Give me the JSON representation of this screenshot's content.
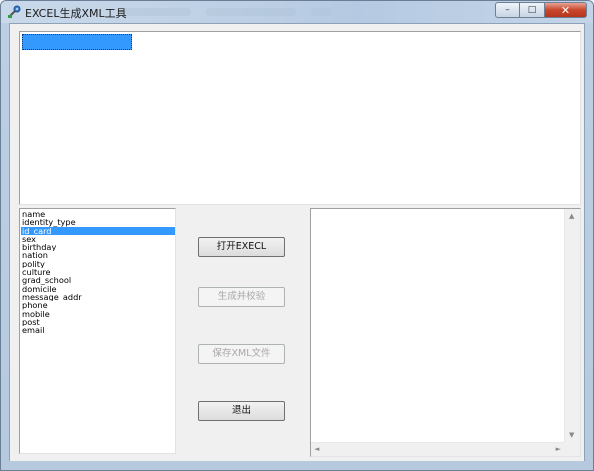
{
  "window": {
    "title": "EXCEL生成XML工具",
    "controls": {
      "minimize": "–",
      "maximize": "□",
      "close": "✕"
    }
  },
  "grid": {},
  "fields": [
    "name",
    "identity_type",
    "id_card",
    "sex",
    "birthday",
    "nation",
    "polity",
    "culture",
    "grad_school",
    "domicile",
    "message_addr",
    "phone",
    "mobile",
    "post",
    "email"
  ],
  "selected_field_index": 2,
  "buttons": {
    "open_excel": "打开EXECL",
    "generate_verify": "生成并校验",
    "save_xml": "保存XML文件",
    "exit": "退出"
  },
  "icons": {
    "app": "tool-icon",
    "scroll_up": "▲",
    "scroll_down": "▼",
    "scroll_left": "◄",
    "scroll_right": "►"
  },
  "colors": {
    "selection": "#3399ff",
    "close_button": "#c9462c"
  }
}
